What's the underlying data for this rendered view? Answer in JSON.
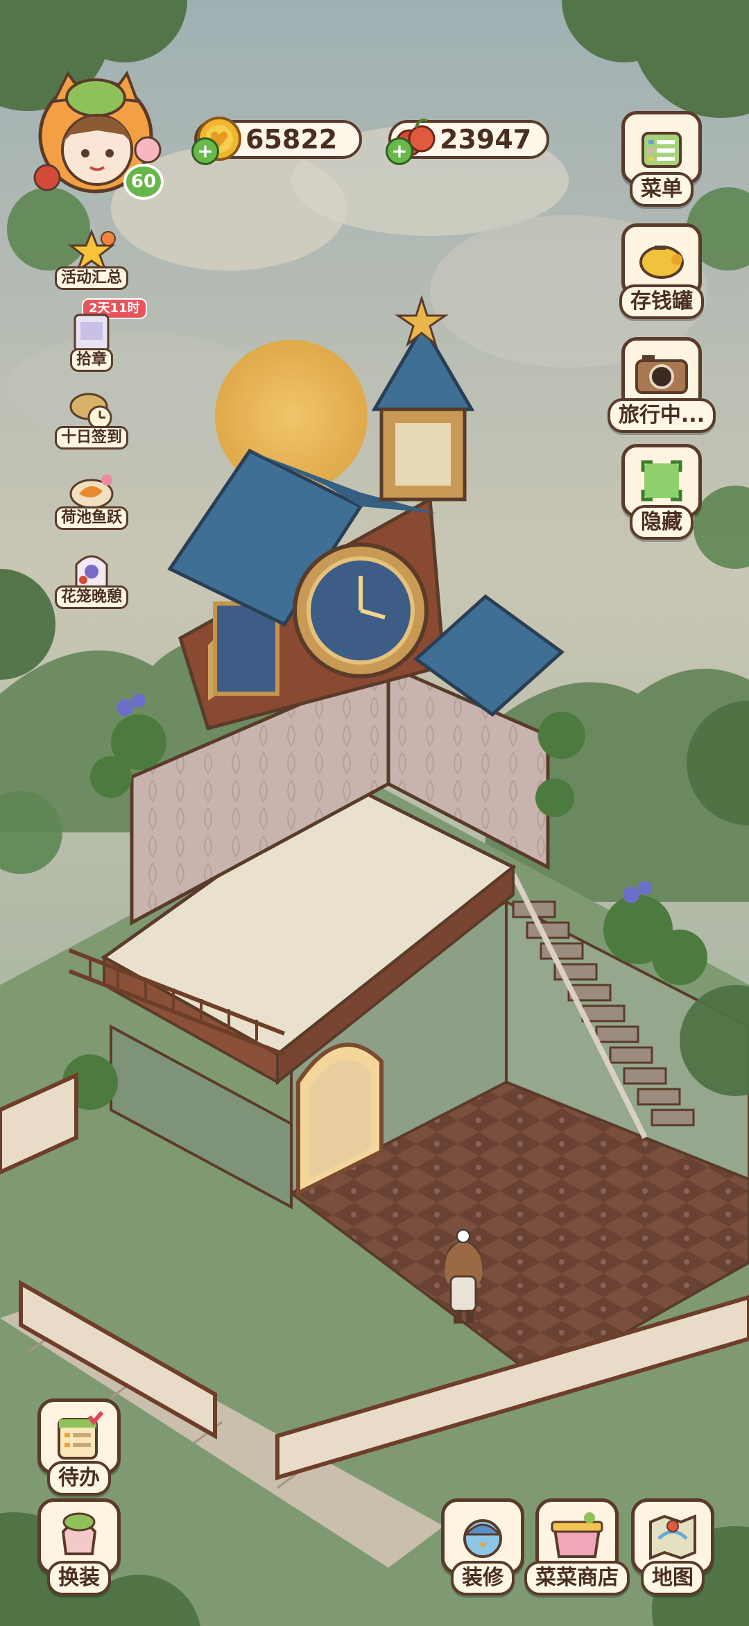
{
  "player": {
    "level": "60"
  },
  "currencies": {
    "gold": "65822",
    "fruit": "23947"
  },
  "left_menu": [
    {
      "label": "活动汇总",
      "icon": "event-summary-icon"
    },
    {
      "label": "拾章",
      "icon": "stamp-collect-icon",
      "badge": "2天11时"
    },
    {
      "label": "十日签到",
      "icon": "ten-day-checkin-icon"
    },
    {
      "label": "荷池鱼跃",
      "icon": "lotus-pond-fish-icon"
    },
    {
      "label": "花笼晚憩",
      "icon": "flower-cage-rest-icon"
    }
  ],
  "right_menu": [
    {
      "label": "菜单",
      "icon": "menu-icon"
    },
    {
      "label": "存钱罐",
      "icon": "piggy-bank-icon"
    },
    {
      "label": "旅行中...",
      "icon": "camera-travel-icon"
    },
    {
      "label": "隐藏",
      "icon": "hide-icon"
    }
  ],
  "bottom_left": [
    {
      "label": "待办",
      "icon": "todo-list-icon"
    },
    {
      "label": "换装",
      "icon": "dress-up-icon"
    }
  ],
  "bottom_right": [
    {
      "label": "装修",
      "icon": "decorate-icon"
    },
    {
      "label": "菜菜商店",
      "icon": "shop-icon"
    },
    {
      "label": "地图",
      "icon": "map-icon"
    }
  ],
  "colors": {
    "sky": "#b9c7c0",
    "grass": "#7f9a73",
    "wood": "#6e3e2a",
    "roof": "#3f6f94",
    "outline": "#5a3b2a",
    "pill_bg": "#fff7ea",
    "green_plus": "#69b84a"
  }
}
